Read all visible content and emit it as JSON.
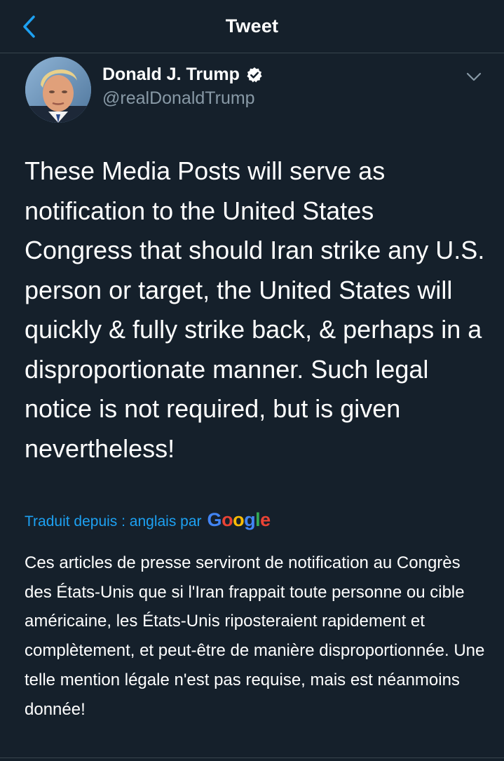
{
  "header": {
    "back_icon": "chevron-left-icon",
    "title": "Tweet"
  },
  "tweet": {
    "author": {
      "display_name": "Donald J. Trump",
      "handle": "@realDonaldTrump",
      "verified": true,
      "verified_icon": "verified-badge-icon"
    },
    "menu_icon": "chevron-down-icon",
    "text": "These Media Posts will serve as notification to the United States Congress that should Iran strike any U.S. person or target, the United States will quickly & fully strike back, & perhaps in a disproportionate manner. Such legal notice is not required, but is given nevertheless!",
    "translation": {
      "label": "Traduit depuis : anglais par",
      "provider": "Google",
      "text": "Ces articles de presse serviront de notification au Congrès des États-Unis que si l'Iran frappait toute personne ou cible américaine, les États-Unis riposteraient rapidement et complètement, et peut-être de manière disproportionnée. Une telle mention légale n'est pas requise, mais est néanmoins donnée!"
    }
  },
  "colors": {
    "background": "#15202b",
    "accent": "#1da1f2",
    "secondary_text": "#8899a6",
    "divider": "#38444d"
  }
}
